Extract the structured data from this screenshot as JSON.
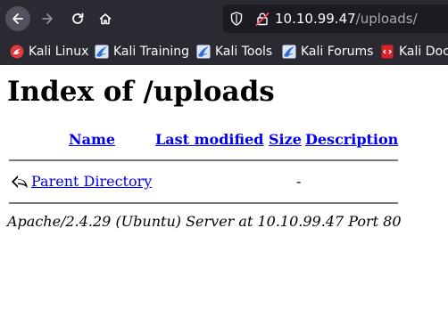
{
  "browser": {
    "url_host": "10.10.99.47",
    "url_path": "/uploads/",
    "icons": [
      "back-icon",
      "forward-icon",
      "reload-icon",
      "home-icon",
      "shield-icon",
      "insecure-lock-icon"
    ]
  },
  "bookmarks": [
    {
      "label": "Kali Linux",
      "icon": "kali-linux-favicon"
    },
    {
      "label": "Kali Training",
      "icon": "kali-dragon-favicon"
    },
    {
      "label": "Kali Tools",
      "icon": "kali-dragon-favicon"
    },
    {
      "label": "Kali Forums",
      "icon": "kali-dragon-favicon"
    },
    {
      "label": "Kali Docs",
      "icon": "kali-docs-favicon"
    }
  ],
  "page": {
    "title": "Index of /uploads",
    "columns": {
      "name": "Name",
      "last_modified": "Last modified",
      "size": "Size",
      "description": "Description"
    },
    "rows": [
      {
        "name": "Parent Directory",
        "size": "-",
        "icon": "back-arrow-icon"
      }
    ],
    "footer": "Apache/2.4.29 (Ubuntu) Server at 10.10.99.47 Port 80"
  }
}
